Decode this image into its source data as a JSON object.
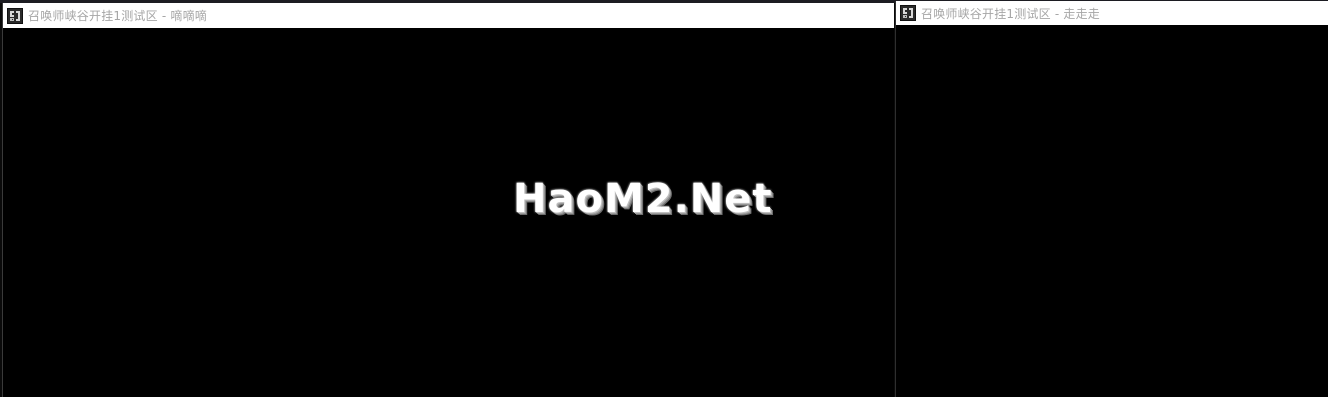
{
  "windows": {
    "left": {
      "title": "召唤师峡谷开挂1测试区 - 嘀嘀嘀",
      "icon": "game-app-icon"
    },
    "right": {
      "title": "召唤师峡谷开挂1测试区 - 走走走",
      "icon": "game-app-icon"
    }
  },
  "watermark": {
    "text": "HaoM2.Net"
  },
  "colors": {
    "titlebar_bg": "#ffffff",
    "title_text": "#a6a6a6",
    "client_bg": "#000000",
    "watermark": "#ffffff"
  }
}
